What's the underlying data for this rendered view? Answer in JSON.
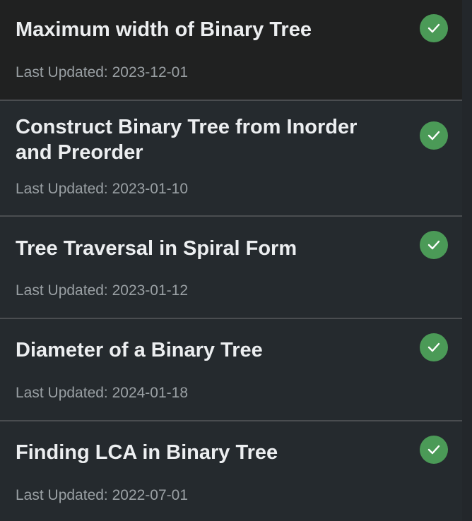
{
  "items": [
    {
      "title": "Maximum width of Binary Tree",
      "updated": "Last Updated: 2023-12-01",
      "status": "completed"
    },
    {
      "title": "Construct Binary Tree from Inorder and Preorder",
      "updated": "Last Updated: 2023-01-10",
      "status": "completed"
    },
    {
      "title": "Tree Traversal in Spiral Form",
      "updated": "Last Updated: 2023-01-12",
      "status": "completed"
    },
    {
      "title": "Diameter of a Binary Tree",
      "updated": "Last Updated: 2024-01-18",
      "status": "completed"
    },
    {
      "title": "Finding LCA in Binary Tree",
      "updated": "Last Updated: 2022-07-01",
      "status": "completed"
    }
  ],
  "colors": {
    "background": "#23272b",
    "selected_background": "#202121",
    "check": "#4b9a57",
    "title_text": "#eceef0",
    "meta_text": "#9aa0a4"
  },
  "icons": {
    "status": "check-circle-icon"
  }
}
